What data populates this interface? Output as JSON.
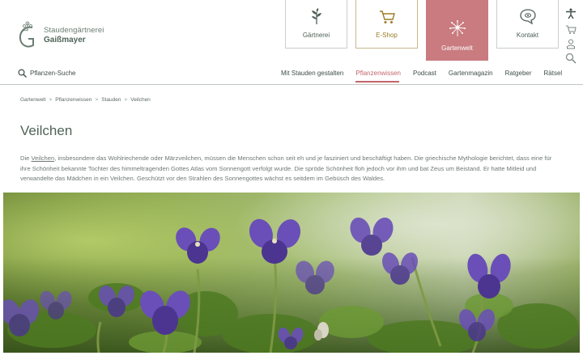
{
  "brand": {
    "line1": "Staudengärtnerei",
    "line2": "Gaißmayer"
  },
  "nav_boxes": [
    {
      "label": "Gärtnerei",
      "icon": "plant-icon"
    },
    {
      "label": "E-Shop",
      "icon": "cart-icon"
    },
    {
      "label": "Gartenwelt",
      "icon": "dandelion-icon"
    },
    {
      "label": "Kontakt",
      "icon": "speech-bubble-icon"
    }
  ],
  "side_icons": [
    "accessibility-icon",
    "cart-icon",
    "user-icon",
    "search-icon"
  ],
  "search": {
    "label": "Pflanzen-Suche"
  },
  "main_nav": [
    {
      "label": "Mit Stauden gestalten",
      "active": false
    },
    {
      "label": "Pflanzenwissen",
      "active": true
    },
    {
      "label": "Podcast",
      "active": false
    },
    {
      "label": "Gartenmagazin",
      "active": false
    },
    {
      "label": "Ratgeber",
      "active": false
    },
    {
      "label": "Rätsel",
      "active": false
    }
  ],
  "breadcrumb": [
    "Gartenwelt",
    "Pflanzenwissen",
    "Stauden",
    "Veilchen"
  ],
  "breadcrumb_separator": ">",
  "page": {
    "title": "Veilchen",
    "intro_prefix": "Die ",
    "intro_link": "Veilchen",
    "intro_text": ", insbesondere das Wohlriechende oder Märzveilchen, müssen die Menschen schon seit eh und je fasziniert und beschäftigt haben. Die griechische Mythologie berichtet, dass eine für ihre Schönheit bekannte Tochter des himmeltragenden Gottes Atlas vom Sonnengott verfolgt wurde. Die spröde Schönheit floh jedoch vor ihm und bat Zeus um Beistand. Er hatte Mitleid und verwandelte das Mädchen in ein Veilchen. Geschützt vor den Strahlen des Sonnengottes wächst es seitdem im Gebüsch des Waldes."
  },
  "colors": {
    "brand_green": "#4f6458",
    "accent_rose": "#c97b7f",
    "active_nav": "#c2666d",
    "shop_gold": "#9b7b26"
  }
}
